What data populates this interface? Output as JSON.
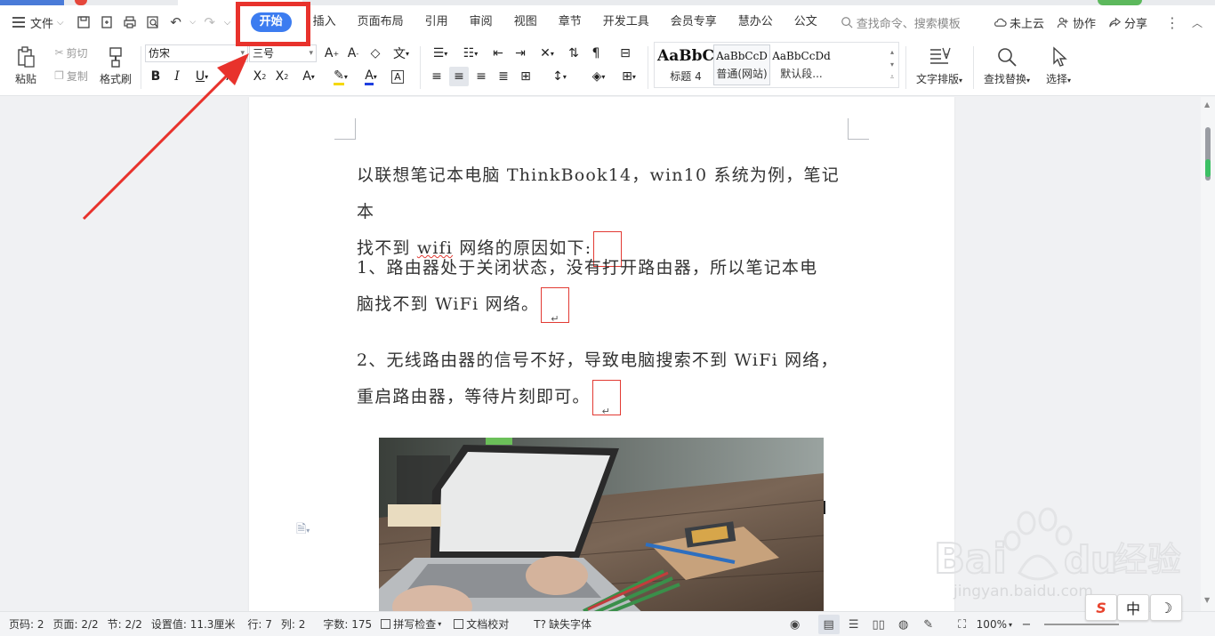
{
  "menubar": {
    "file_label": "文件",
    "tabs": [
      "开始",
      "插入",
      "页面布局",
      "引用",
      "审阅",
      "视图",
      "章节",
      "开发工具",
      "会员专享",
      "慧办公",
      "公文"
    ],
    "search_placeholder": "查找命令、搜索模板",
    "cloud_label": "未上云",
    "collab_label": "协作",
    "share_label": "分享"
  },
  "ribbon": {
    "paste_label": "粘贴",
    "cut_label": "剪切",
    "copy_label": "复制",
    "format_painter_label": "格式刷",
    "font_name": "仿宋",
    "font_size": "三号",
    "styles": [
      {
        "sample": "AaBbC",
        "name": "标题 4"
      },
      {
        "sample": "AaBbCcD",
        "name": "普通(网站)"
      },
      {
        "sample": "AaBbCcDd",
        "name": "默认段..."
      }
    ],
    "text_layout_label": "文字排版",
    "find_replace_label": "查找替换",
    "select_label": "选择"
  },
  "document": {
    "p1_line1": "以联想笔记本电脑 ThinkBook14，win10 系统为例，笔记本",
    "p1_line2a": "找不到",
    "p1_line2_wifi": "wifi",
    "p1_line2b": "网络的原因如下:",
    "p2_line1": "1、路由器处于关闭状态，没有打开路由器，所以笔记本电",
    "p2_line2": "脑找不到 WiFi 网络。",
    "p3_line1": "2、无线路由器的信号不好，导致电脑搜索不到 WiFi 网络，",
    "p3_line2": "重启路由器，等待片刻即可。",
    "para_mark": "↵"
  },
  "statusbar": {
    "page_num": "页码: 2",
    "pages": "页面: 2/2",
    "section": "节: 2/2",
    "setting": "设置值: 11.3厘米",
    "row": "行: 7",
    "col": "列: 2",
    "word_count": "字数: 175",
    "spellcheck": "拼写检查",
    "doc_proof": "文档校对",
    "missing_font": "缺失字体",
    "zoom": "100%"
  },
  "ime": {
    "sogou": "S",
    "lang": "中",
    "moon": "☽"
  },
  "watermark": {
    "brand": "Bai",
    "brand2": "du",
    "cn": "经验",
    "url": "jingyan.baidu.com"
  },
  "colors": {
    "accent": "#3c7cf0",
    "highlight": "#e8322c"
  }
}
